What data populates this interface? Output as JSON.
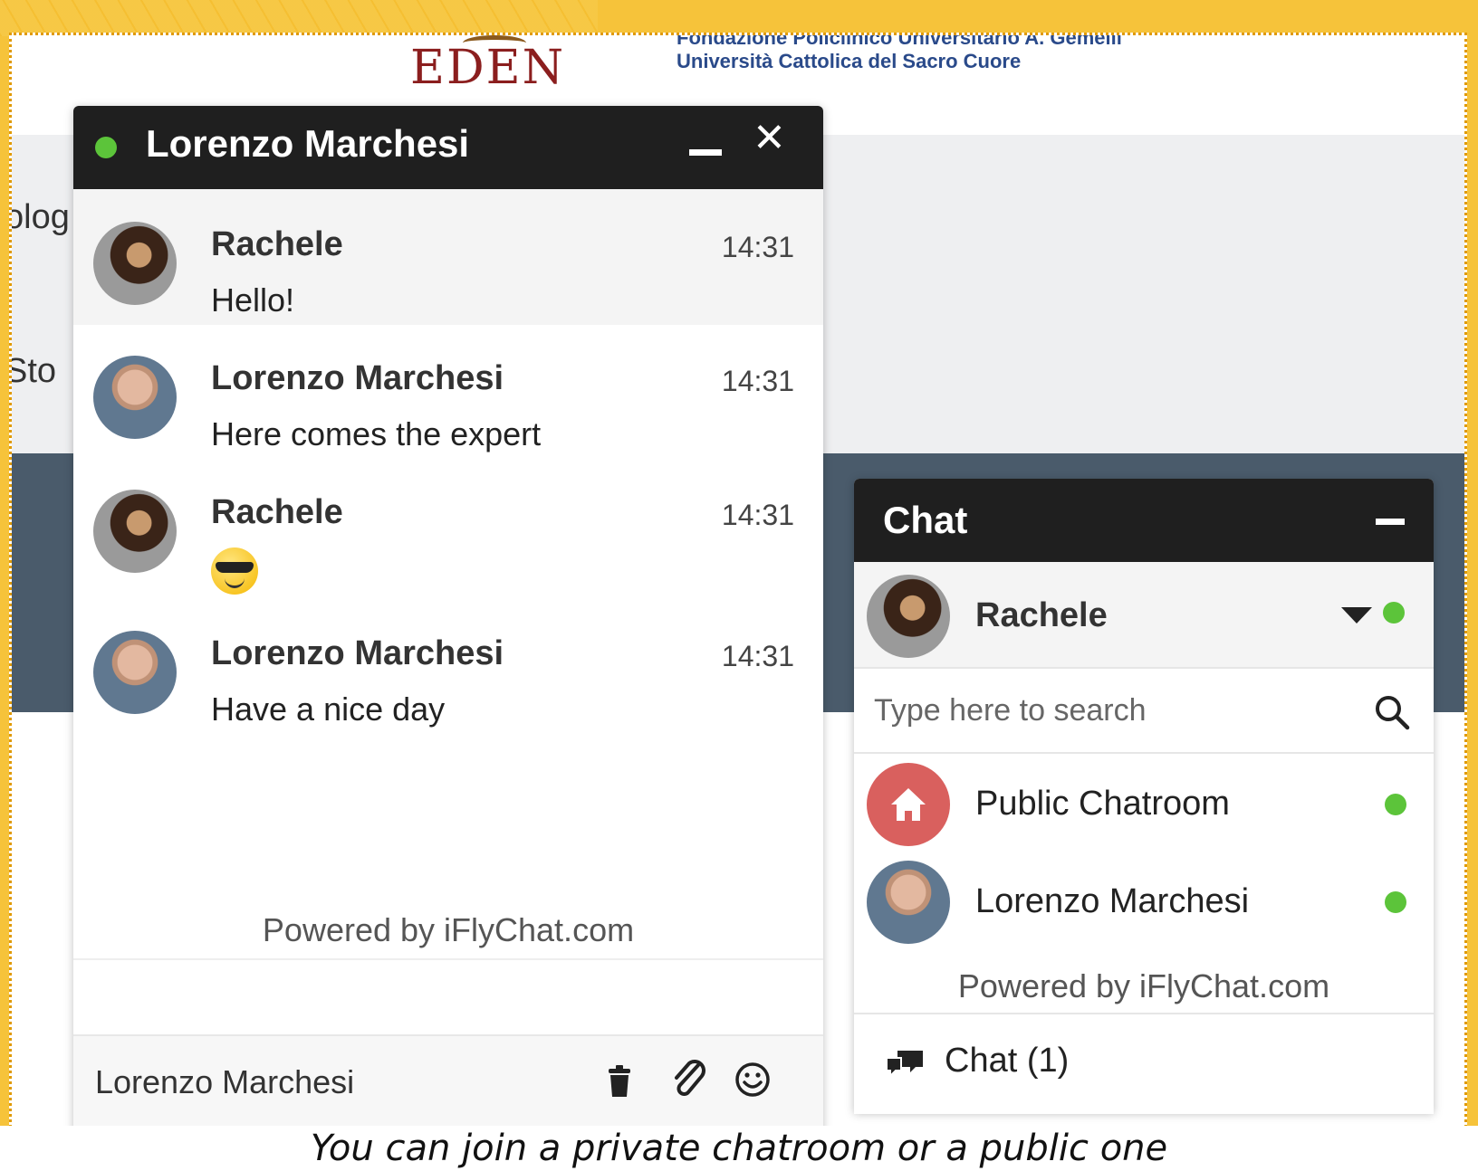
{
  "site": {
    "logo": "EDEN",
    "institution_line1": "Fondazione Policlinico Universitario A. Gemelli",
    "institution_line2": "Università Cattolica del Sacro Cuore",
    "nav_fragment_1": "olog",
    "nav_fragment_2": "Sto"
  },
  "conversation": {
    "title": "Lorenzo Marchesi",
    "status_color": "#5cc43a",
    "messages": [
      {
        "sender": "Rachele",
        "time": "14:31",
        "text": "Hello!"
      },
      {
        "sender": "Lorenzo Marchesi",
        "time": "14:31",
        "text": "Here comes the expert"
      },
      {
        "sender": "Rachele",
        "time": "14:31",
        "text": "",
        "emoji": "sunglasses-emoji"
      },
      {
        "sender": "Lorenzo Marchesi",
        "time": "14:31",
        "text": "Have a nice day"
      }
    ],
    "powered_by": "Powered by iFlyChat.com",
    "footer_name": "Lorenzo Marchesi"
  },
  "chat_panel": {
    "title": "Chat",
    "current_user": "Rachele",
    "search_placeholder": "Type here to search",
    "contacts": [
      {
        "name": "Public Chatroom",
        "icon": "home-icon",
        "online": true
      },
      {
        "name": "Lorenzo Marchesi",
        "online": true
      }
    ],
    "powered_by": "Powered by iFlyChat.com",
    "footer_label": "Chat (1)"
  },
  "caption": "You can join a private chatroom or a public one",
  "colors": {
    "header_bar": "#1f1f1f",
    "online_green": "#5cc43a",
    "public_room_red": "#d9605e",
    "slide_background": "#f6c33a"
  }
}
